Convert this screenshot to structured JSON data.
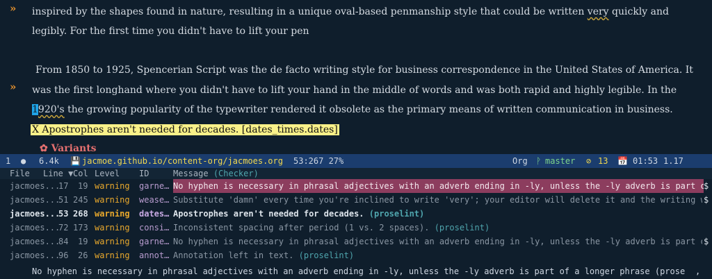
{
  "editor": {
    "line1": {
      "fringe": "»",
      "pre": "inspired by the shapes found in nature, resulting in a unique oval-based penmanship style that could be written ",
      "ul": "very",
      "post": " quickly and"
    },
    "line2": "legibly.  For the first time you didn't have to lift your pen",
    "line4": "From 1850 to 1925, Spencerian Script was the de facto writing style for business correspondence in the United States of America.  It",
    "line5": {
      "fringe": "»",
      "text": "was the first longhand where you didn't have to lift your hand in the middle of words and was both rapid and highly legible.  In the"
    },
    "line6": {
      "cursor": "1",
      "ul": "920's",
      "post": " the growing popularity of the typewriter rendered it obsolete as the primary means of written communication in business."
    },
    "error_line": "X Apostrophes aren't needed for decades. [dates_times.dates]",
    "heading": "✿ Variants"
  },
  "modeline": {
    "window": "1",
    "status_dot": "●",
    "size": "6.4k",
    "save_icon": "💾",
    "buffer": "jacmoe.github.io/content-org/jacmoes.org",
    "position": "53:267 27%",
    "mode": "Org",
    "branch_icon": "ᚹ",
    "branch": "master",
    "errors_icon": "⊘",
    "errors": "13",
    "clock_icon": "📅",
    "time": "01:53",
    "load": "1.17"
  },
  "list": {
    "headers": {
      "file": "File",
      "line": "Line ▼",
      "col": "Col",
      "level": "Level",
      "id": "ID",
      "message": "Message",
      "checker": "(Checker)"
    },
    "rows": [
      {
        "file": "jacmoes...",
        "line": "17",
        "col": "19",
        "level": "warning",
        "id": "garne…",
        "message": "No hyphen is necessary in phrasal adjectives with an adverb ending in -ly, unless the -ly adverb is part o",
        "checker": "",
        "trunc": "$"
      },
      {
        "file": "jacmoes...",
        "line": "51",
        "col": "245",
        "level": "warning",
        "id": "wease…",
        "message": "Substitute 'damn' every time you're inclined to write 'very'; your editor will delete it and the writing w",
        "checker": "",
        "trunc": "$"
      },
      {
        "file": "jacmoes...",
        "line": "53",
        "col": "268",
        "level": "warning",
        "id": "dates…",
        "message": "Apostrophes aren't needed for decades.",
        "checker": "(proselint)",
        "trunc": ""
      },
      {
        "file": "jacmoes...",
        "line": "72",
        "col": "173",
        "level": "warning",
        "id": "consi…",
        "message": "Inconsistent spacing after period (1 vs. 2 spaces).",
        "checker": "(proselint)",
        "trunc": ""
      },
      {
        "file": "jacmoes...",
        "line": "84",
        "col": "19",
        "level": "warning",
        "id": "garne…",
        "message": "No hyphen is necessary in phrasal adjectives with an adverb ending in -ly, unless the -ly adverb is part o",
        "checker": "",
        "trunc": "$"
      },
      {
        "file": "jacmoes...",
        "line": "96",
        "col": "26",
        "level": "warning",
        "id": "annot…",
        "message": "Annotation left in text.",
        "checker": "(proselint)",
        "trunc": ""
      }
    ]
  },
  "echo": {
    "text": "No hyphen is necessary in phrasal adjectives with an adverb ending in -ly, unless the -ly adverb is part of a longer phrase (prose",
    "trunc": ","
  }
}
